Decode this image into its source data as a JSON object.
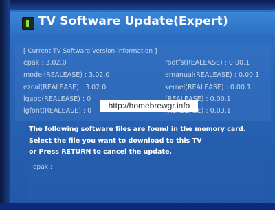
{
  "window": {
    "title": "TV Software Update(Expert)"
  },
  "info": {
    "header": "[ Current TV Software Version Information ]",
    "left": [
      "epak : 3.02.0",
      "model(REALEASE) : 3.02.0",
      "ezcal(REALEASE) : 3.02.0",
      "lgapp(REALEASE) : 0",
      "lgfont(REALEASE) : 0"
    ],
    "right": [
      "rootfs(REALEASE) : 0.00.1",
      "emanual(REALEASE) : 0.00.1",
      "kernel(REALEASE) : 0.00.1",
      "(REALEASE) : 0.00.1",
      "(REALEASE) : 0.03.1"
    ]
  },
  "watermark": "http://homebrewgr.info",
  "message": {
    "line1": "The following software files are found in the memory card.",
    "line2": "Select the file you want to download to this TV",
    "line3": "or Press RETURN to cancel the update."
  },
  "files": [
    "epak :"
  ]
}
